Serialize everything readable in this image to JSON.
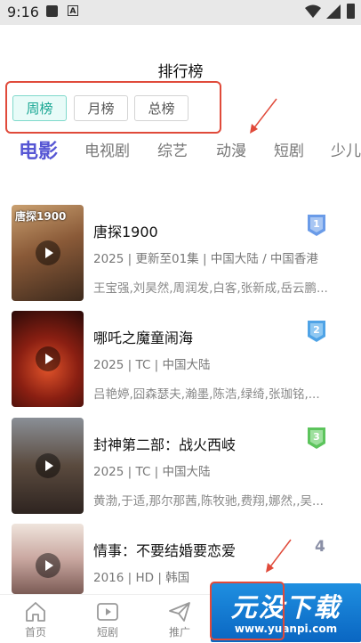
{
  "status_bar": {
    "time": "9:16"
  },
  "page": {
    "title": "排行榜"
  },
  "period_tabs": [
    {
      "label": "周榜",
      "active": true
    },
    {
      "label": "月榜",
      "active": false
    },
    {
      "label": "总榜",
      "active": false
    }
  ],
  "categories": [
    {
      "label": "电影",
      "active": true
    },
    {
      "label": "电视剧",
      "active": false
    },
    {
      "label": "综艺",
      "active": false
    },
    {
      "label": "动漫",
      "active": false
    },
    {
      "label": "短剧",
      "active": false
    },
    {
      "label": "少儿",
      "active": false
    }
  ],
  "items": [
    {
      "rank": "1",
      "title": "唐探1900",
      "meta": "2025 | 更新至01集 | 中国大陆 / 中国香港",
      "cast": "王宝强,刘昊然,周润发,白客,张新成,岳云鹏...",
      "poster_text": "唐探1900",
      "badge_color": "#6a9be8"
    },
    {
      "rank": "2",
      "title": "哪吒之魔童闹海",
      "meta": "2025 | TC | 中国大陆",
      "cast": "吕艳婷,囧森瑟夫,瀚墨,陈浩,绿绮,张珈铭,...",
      "poster_text": "",
      "badge_color": "#4fa3e6"
    },
    {
      "rank": "3",
      "title": "封神第二部：战火西岐",
      "meta": "2025 | TC | 中国大陆",
      "cast": "黄渤,于适,那尔那茜,陈牧驰,费翔,娜然,,吴...",
      "poster_text": "",
      "badge_color": "#5cc45c"
    },
    {
      "rank": "4",
      "title": "情事：不要结婚要恋爱",
      "meta": "2016 | HD | 韩国",
      "cast": "",
      "poster_text": "",
      "badge_color": ""
    }
  ],
  "bottom_nav": [
    {
      "label": "首页",
      "icon": "home-icon"
    },
    {
      "label": "短剧",
      "icon": "play-square-icon"
    },
    {
      "label": "推广",
      "icon": "paper-plane-icon"
    }
  ],
  "watermark": {
    "main": "元没下载",
    "sub": "www.yuanpi.com"
  },
  "colors": {
    "accent": "#5656d4",
    "active_tab_text": "#1aa794",
    "annotation": "#e04a3a"
  }
}
